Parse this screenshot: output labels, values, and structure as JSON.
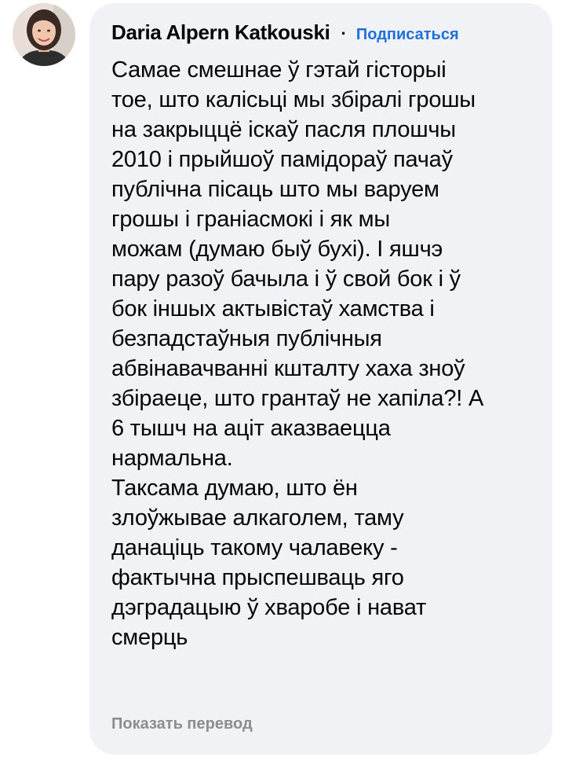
{
  "comment": {
    "author": "Daria Alpern Katkouski",
    "separator": "·",
    "subscribe_label": "Подписаться",
    "lines": [
      "Самае смешнае ў гэтай гісторыі",
      "тое, што калісьці мы збіралі грошы",
      "на закрыццё іскаў пасля плошчы",
      "2010 і прыйшоў памідораў пачаў",
      "публічна пісаць што мы варуем",
      "грошы і граніасмокі і як мы",
      "можам (думаю быў бухі). І яшчэ",
      "пару разоў бачыла і ў свой бок і ў",
      "бок іншых актывістаў хамства і",
      "безпадстаўныя публічныя",
      "абвінавачванні кшталту хаха зноў",
      "збіраеце, што грантаў не хапіла?! А",
      "6 тышч на аціт аказваецца",
      "нармальна.",
      "Таксама думаю, што ён",
      "злоўжывае алкаголем, таму",
      "данаціць такому чалавеку -",
      "фактычна прыспешваць яго",
      "дэградацыю ў хваробе і нават",
      "смерць"
    ],
    "translate_label": "Показать перевод"
  },
  "colors": {
    "bubble_bg": "#f0f2f5",
    "author_text": "#050505",
    "link_blue": "#216fdb",
    "muted_gray": "#8a8d91"
  },
  "icons": {
    "avatar": "user-avatar-photo"
  }
}
